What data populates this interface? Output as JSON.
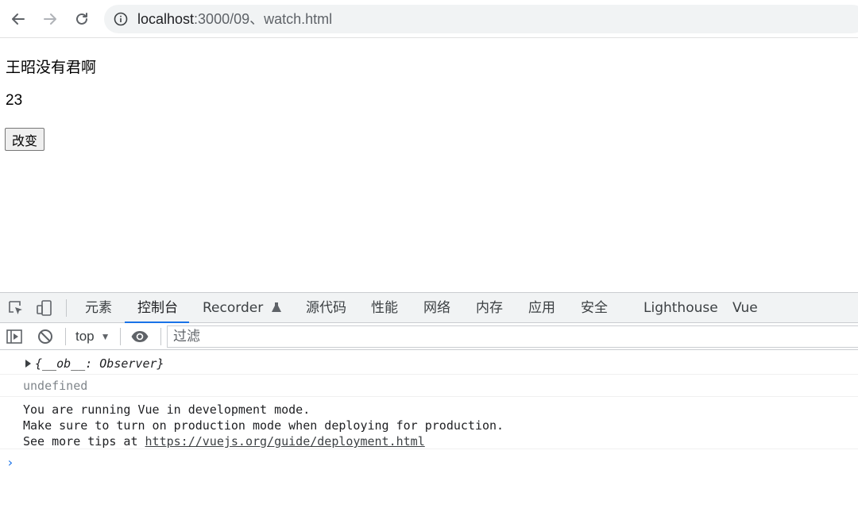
{
  "browser": {
    "url_host": "localhost",
    "url_path": ":3000/09、watch.html"
  },
  "page": {
    "name_text": "王昭没有君啊",
    "age_text": "23",
    "change_button_label": "改变"
  },
  "devtools": {
    "tabs": [
      {
        "label": "元素"
      },
      {
        "label": "控制台",
        "active": true
      },
      {
        "label": "Recorder"
      },
      {
        "label": "源代码"
      },
      {
        "label": "性能"
      },
      {
        "label": "网络"
      },
      {
        "label": "内存"
      },
      {
        "label": "应用"
      },
      {
        "label": "安全"
      },
      {
        "label": "Lighthouse"
      },
      {
        "label": "Vue"
      }
    ],
    "context_selector": "top",
    "filter_placeholder": "过滤",
    "accent_color": "#1a73e8",
    "console": {
      "object_message": "{__ob__: Observer}",
      "undefined_message": "undefined",
      "info_line_1": "You are running Vue in development mode.",
      "info_line_2": "Make sure to turn on production mode when deploying for production.",
      "info_line_3_prefix": "See more tips at ",
      "info_link": "https://vuejs.org/guide/deployment.html"
    }
  }
}
